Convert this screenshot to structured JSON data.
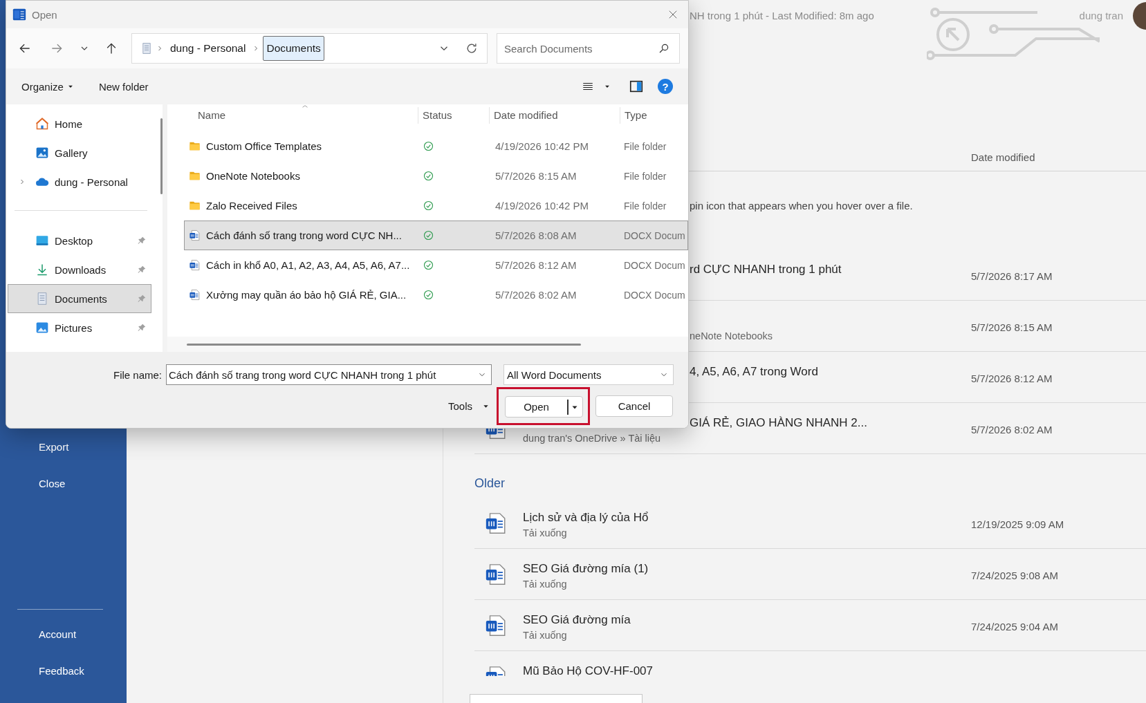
{
  "backstage": {
    "document_title": "NH trong 1 phút  -  Last Modified: 8m ago",
    "user_name": "dung tran",
    "nav_items": [
      {
        "label": "Export"
      },
      {
        "label": "Close"
      }
    ],
    "nav_bottom_items": [
      {
        "label": "Account"
      },
      {
        "label": "Feedback"
      }
    ],
    "recent": {
      "date_column": "Date modified",
      "pinned_hint": "pin icon that appears when you hover over a file.",
      "items": [
        {
          "kind": "covered",
          "title": "rd CỰC NHANH trong 1 phút",
          "date": "5/7/2026 8:17 AM"
        },
        {
          "kind": "covered",
          "location": "neNote Notebooks",
          "date": "5/7/2026 8:15 AM"
        },
        {
          "kind": "covered",
          "title": "4, A5, A6, A7 trong Word",
          "date": "5/7/2026 8:12 AM"
        },
        {
          "kind": "partly_covered",
          "title": "GIÁ RẺ, GIAO HÀNG NHANH 2...",
          "location": "dung tran's OneDrive » Tài liệu",
          "date": "5/7/2026 8:02 AM"
        }
      ],
      "older_heading": "Older",
      "older_items": [
        {
          "kind": "full",
          "title": "Lịch sử và địa lý của Hổ",
          "location": "Tải xuống",
          "date": "12/19/2025 9:09 AM"
        },
        {
          "kind": "full",
          "title": "SEO Giá đường mía (1)",
          "location": "Tải xuống",
          "date": "7/24/2025 9:08 AM"
        },
        {
          "kind": "full",
          "title": "SEO Giá đường mía",
          "location": "Tải xuống",
          "date": "7/24/2025 9:04 AM"
        },
        {
          "kind": "full",
          "title": "Mũ Bảo Hộ COV-HF-007"
        }
      ]
    }
  },
  "dialog": {
    "title": "Open",
    "breadcrumbs": [
      {
        "label": "dung - Personal",
        "selected": false
      },
      {
        "label": "Documents",
        "selected": true
      }
    ],
    "search": {
      "placeholder": "Search Documents"
    },
    "toolbar": {
      "organize": "Organize",
      "new_folder": "New folder",
      "help": "?"
    },
    "nav_groups": [
      [
        {
          "kind": "home",
          "label": "Home",
          "selected": false
        },
        {
          "kind": "gallery",
          "label": "Gallery",
          "selected": false
        },
        {
          "kind": "cloud",
          "label": "dung - Personal",
          "expanded": false,
          "selected": false
        }
      ],
      [
        {
          "kind": "desktop",
          "label": "Desktop",
          "pinned": true,
          "selected": false
        },
        {
          "kind": "downloads",
          "label": "Downloads",
          "pinned": true,
          "selected": false
        },
        {
          "kind": "documents",
          "label": "Documents",
          "pinned": true,
          "selected": true
        },
        {
          "kind": "pictures",
          "label": "Pictures",
          "pinned": true,
          "selected": false
        }
      ]
    ],
    "columns": [
      "Name",
      "Status",
      "Date modified",
      "Type"
    ],
    "files": [
      {
        "kind": "folder",
        "name": "Custom Office Templates",
        "date": "4/19/2026 10:42 PM",
        "type": "File folder",
        "selected": false
      },
      {
        "kind": "folder",
        "name": "OneNote Notebooks",
        "date": "5/7/2026 8:15 AM",
        "type": "File folder",
        "selected": false
      },
      {
        "kind": "folder",
        "name": "Zalo Received Files",
        "date": "4/19/2026 10:42 PM",
        "type": "File folder",
        "selected": false
      },
      {
        "kind": "docx",
        "name": "Cách đánh số trang trong word CỰC NH...",
        "date": "5/7/2026 8:08 AM",
        "type": "DOCX Docum",
        "selected": true
      },
      {
        "kind": "docx",
        "name": "Cách in khổ A0, A1, A2, A3, A4, A5, A6, A7...",
        "date": "5/7/2026 8:12 AM",
        "type": "DOCX Docum",
        "selected": false
      },
      {
        "kind": "docx",
        "name": "Xưởng may quần áo bảo hộ GIÁ RẺ, GIA...",
        "date": "5/7/2026 8:02 AM",
        "type": "DOCX Docum",
        "selected": false
      }
    ],
    "file_name_label": "File name:",
    "file_name": "Cách đánh số trang trong word CỰC NHANH trong 1 phút",
    "file_type": "All Word Documents",
    "tools": "Tools",
    "open": "Open",
    "cancel": "Cancel"
  }
}
